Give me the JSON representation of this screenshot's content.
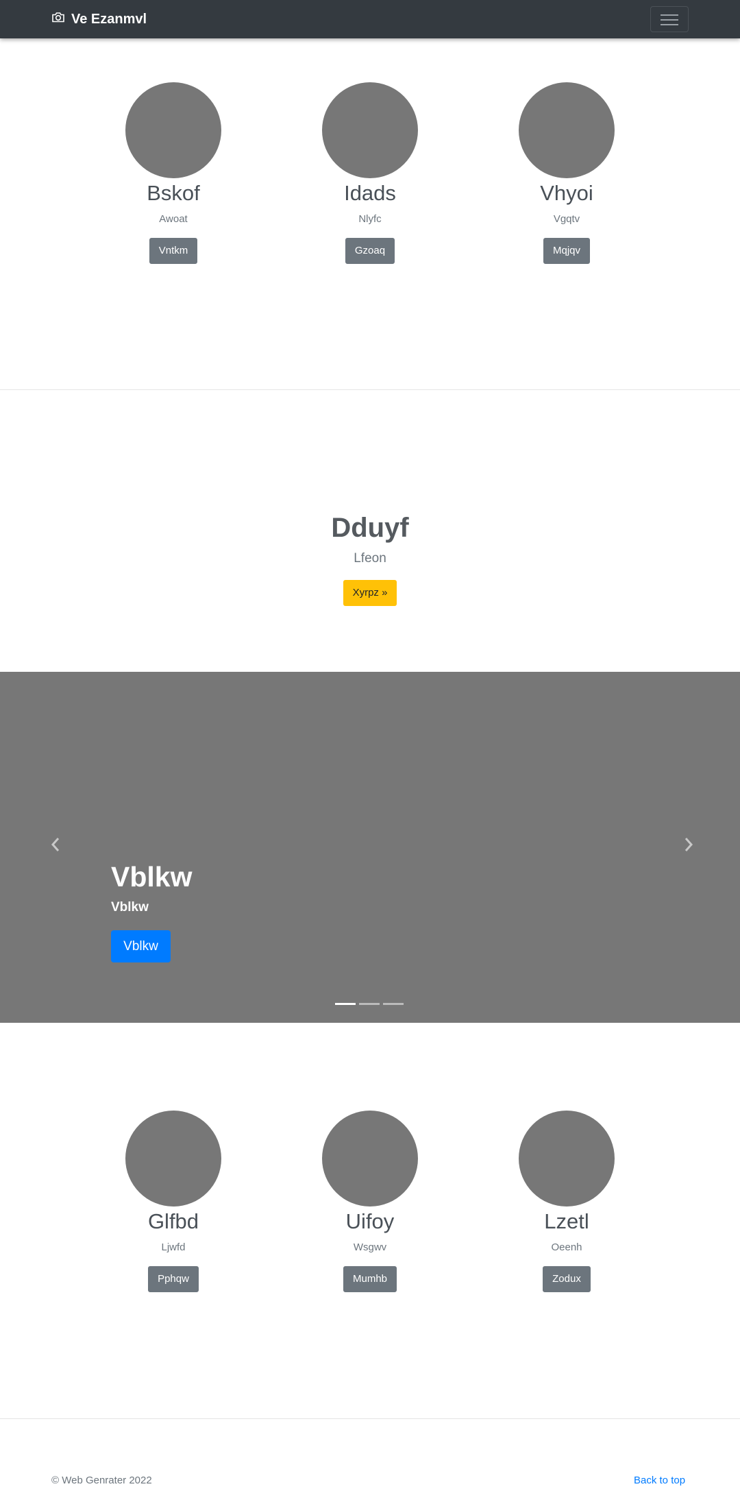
{
  "navbar": {
    "brand": "Ve Ezanmvl",
    "brand_icon": "camera-icon",
    "toggler_icon": "hamburger-icon"
  },
  "features_top": [
    {
      "title": "Bskof",
      "text": "Awoat",
      "button": "Vntkm"
    },
    {
      "title": "Idads",
      "text": "Nlyfc",
      "button": "Gzoaq"
    },
    {
      "title": "Vhyoi",
      "text": "Vgqtv",
      "button": "Mqjqv"
    }
  ],
  "hero": {
    "title": "Dduyf",
    "lead": "Lfeon",
    "button": "Xyrpz »"
  },
  "carousel": {
    "title": "Vblkw",
    "subtitle": "Vblkw",
    "button": "Vblkw",
    "prev_icon": "chevron-left-icon",
    "next_icon": "chevron-right-icon",
    "indicators": 3,
    "active_index": 0
  },
  "features_bottom": [
    {
      "title": "Glfbd",
      "text": "Ljwfd",
      "button": "Pphqw"
    },
    {
      "title": "Uifoy",
      "text": "Wsgwv",
      "button": "Mumhb"
    },
    {
      "title": "Lzetl",
      "text": "Oeenh",
      "button": "Zodux"
    }
  ],
  "footer": {
    "copyright": "© Web Genrater 2022",
    "back_to_top": "Back to top"
  },
  "colors": {
    "navbar": "#343a40",
    "placeholder": "#777777",
    "primary": "#007bff",
    "warning": "#ffc107",
    "secondary": "#6c757d"
  }
}
